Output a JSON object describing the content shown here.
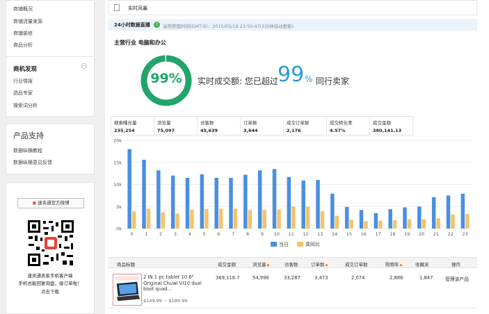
{
  "sidebar": {
    "store_links": [
      "商铺概况",
      "商铺流量来源",
      "商铺装修",
      "商品分析"
    ],
    "discovery_title": "商机发现",
    "discovery_links": [
      "行业情报",
      "选品专家",
      "搜索词分析"
    ],
    "support_title": "产品支持",
    "support_links": [
      "数据纵横教程",
      "数据纵横意见反馈"
    ],
    "weibo_label": "速卖通官方微博",
    "qr_caption": [
      "速卖通卖家手机客户端",
      "手机也能回复询盘，接订单啦！",
      "点击下载"
    ]
  },
  "header": {
    "section_title": "实时风暴",
    "live_label": "24小时数据直播",
    "timezone_note": "采用美国时间(GMT-8)：2015/05/18 23:50:47(5分钟自动更新)"
  },
  "industry": {
    "label": "主营行业 电脑和办公"
  },
  "summary": {
    "ring_value": "99%",
    "ring_percent": 99,
    "text_before": "实时成交额: 您已超过",
    "big_value": "99",
    "percent_sign": "%",
    "text_after": "同行卖家"
  },
  "stats": [
    {
      "label": "搜索曝光量",
      "value": "235,254"
    },
    {
      "label": "浏览量",
      "value": "75,097"
    },
    {
      "label": "访客数",
      "value": "45,639"
    },
    {
      "label": "订单数",
      "value": "3,644"
    },
    {
      "label": "成交订单数",
      "value": "2,176"
    },
    {
      "label": "成交转化率",
      "value": "4.57%"
    },
    {
      "label": "成交金额",
      "value": "380,141.13"
    }
  ],
  "colors": {
    "ring": "#22a46a",
    "today": "#4a8fe0",
    "last_week": "#f5c26b",
    "accent": "#2a9ad6"
  },
  "chart_data": {
    "type": "bar",
    "categories": [
      "0",
      "1",
      "2",
      "3",
      "4",
      "5",
      "6",
      "7",
      "8",
      "9",
      "10",
      "11",
      "12",
      "13",
      "14",
      "15",
      "16",
      "17",
      "18",
      "19",
      "20",
      "21",
      "22",
      "23"
    ],
    "ylim": [
      0,
      20000
    ],
    "ytick_labels": [
      "0k",
      "5k",
      "10k",
      "15k",
      "20k"
    ],
    "series": [
      {
        "name": "当日",
        "values": [
          18000,
          15600,
          13200,
          12000,
          11500,
          12300,
          11500,
          11500,
          12200,
          13200,
          13500,
          11700,
          10900,
          11000,
          7900,
          4900,
          4200,
          3500,
          4400,
          4800,
          5000,
          7100,
          7500,
          7900
        ]
      },
      {
        "name": "周同比",
        "values": [
          3900,
          4500,
          3700,
          3400,
          4300,
          4400,
          4500,
          4500,
          4200,
          4200,
          4300,
          5000,
          5000,
          3900,
          2900,
          2000,
          1700,
          1800,
          1900,
          2100,
          2100,
          2300,
          3200,
          3300
        ]
      }
    ],
    "legend_position": "bottom-center"
  },
  "table": {
    "headers": [
      "商品标题",
      "成交金额",
      "浏览量",
      "访客数",
      "订单数",
      "成交订单数",
      "购物车",
      "收藏夹",
      "操作"
    ],
    "rows": [
      {
        "title": "2 IN 1 pc tablet 10.6\" Original Chuwi VI10 dual boot quad...",
        "price": "$149.99 ~ $189.99",
        "amount": "369,116.7",
        "views": "54,996",
        "visitors": "33,287",
        "orders": "3,473",
        "paid_orders": "2,074",
        "cart": "2,886",
        "favorites": "1,847",
        "action": "管理该产品"
      }
    ]
  }
}
